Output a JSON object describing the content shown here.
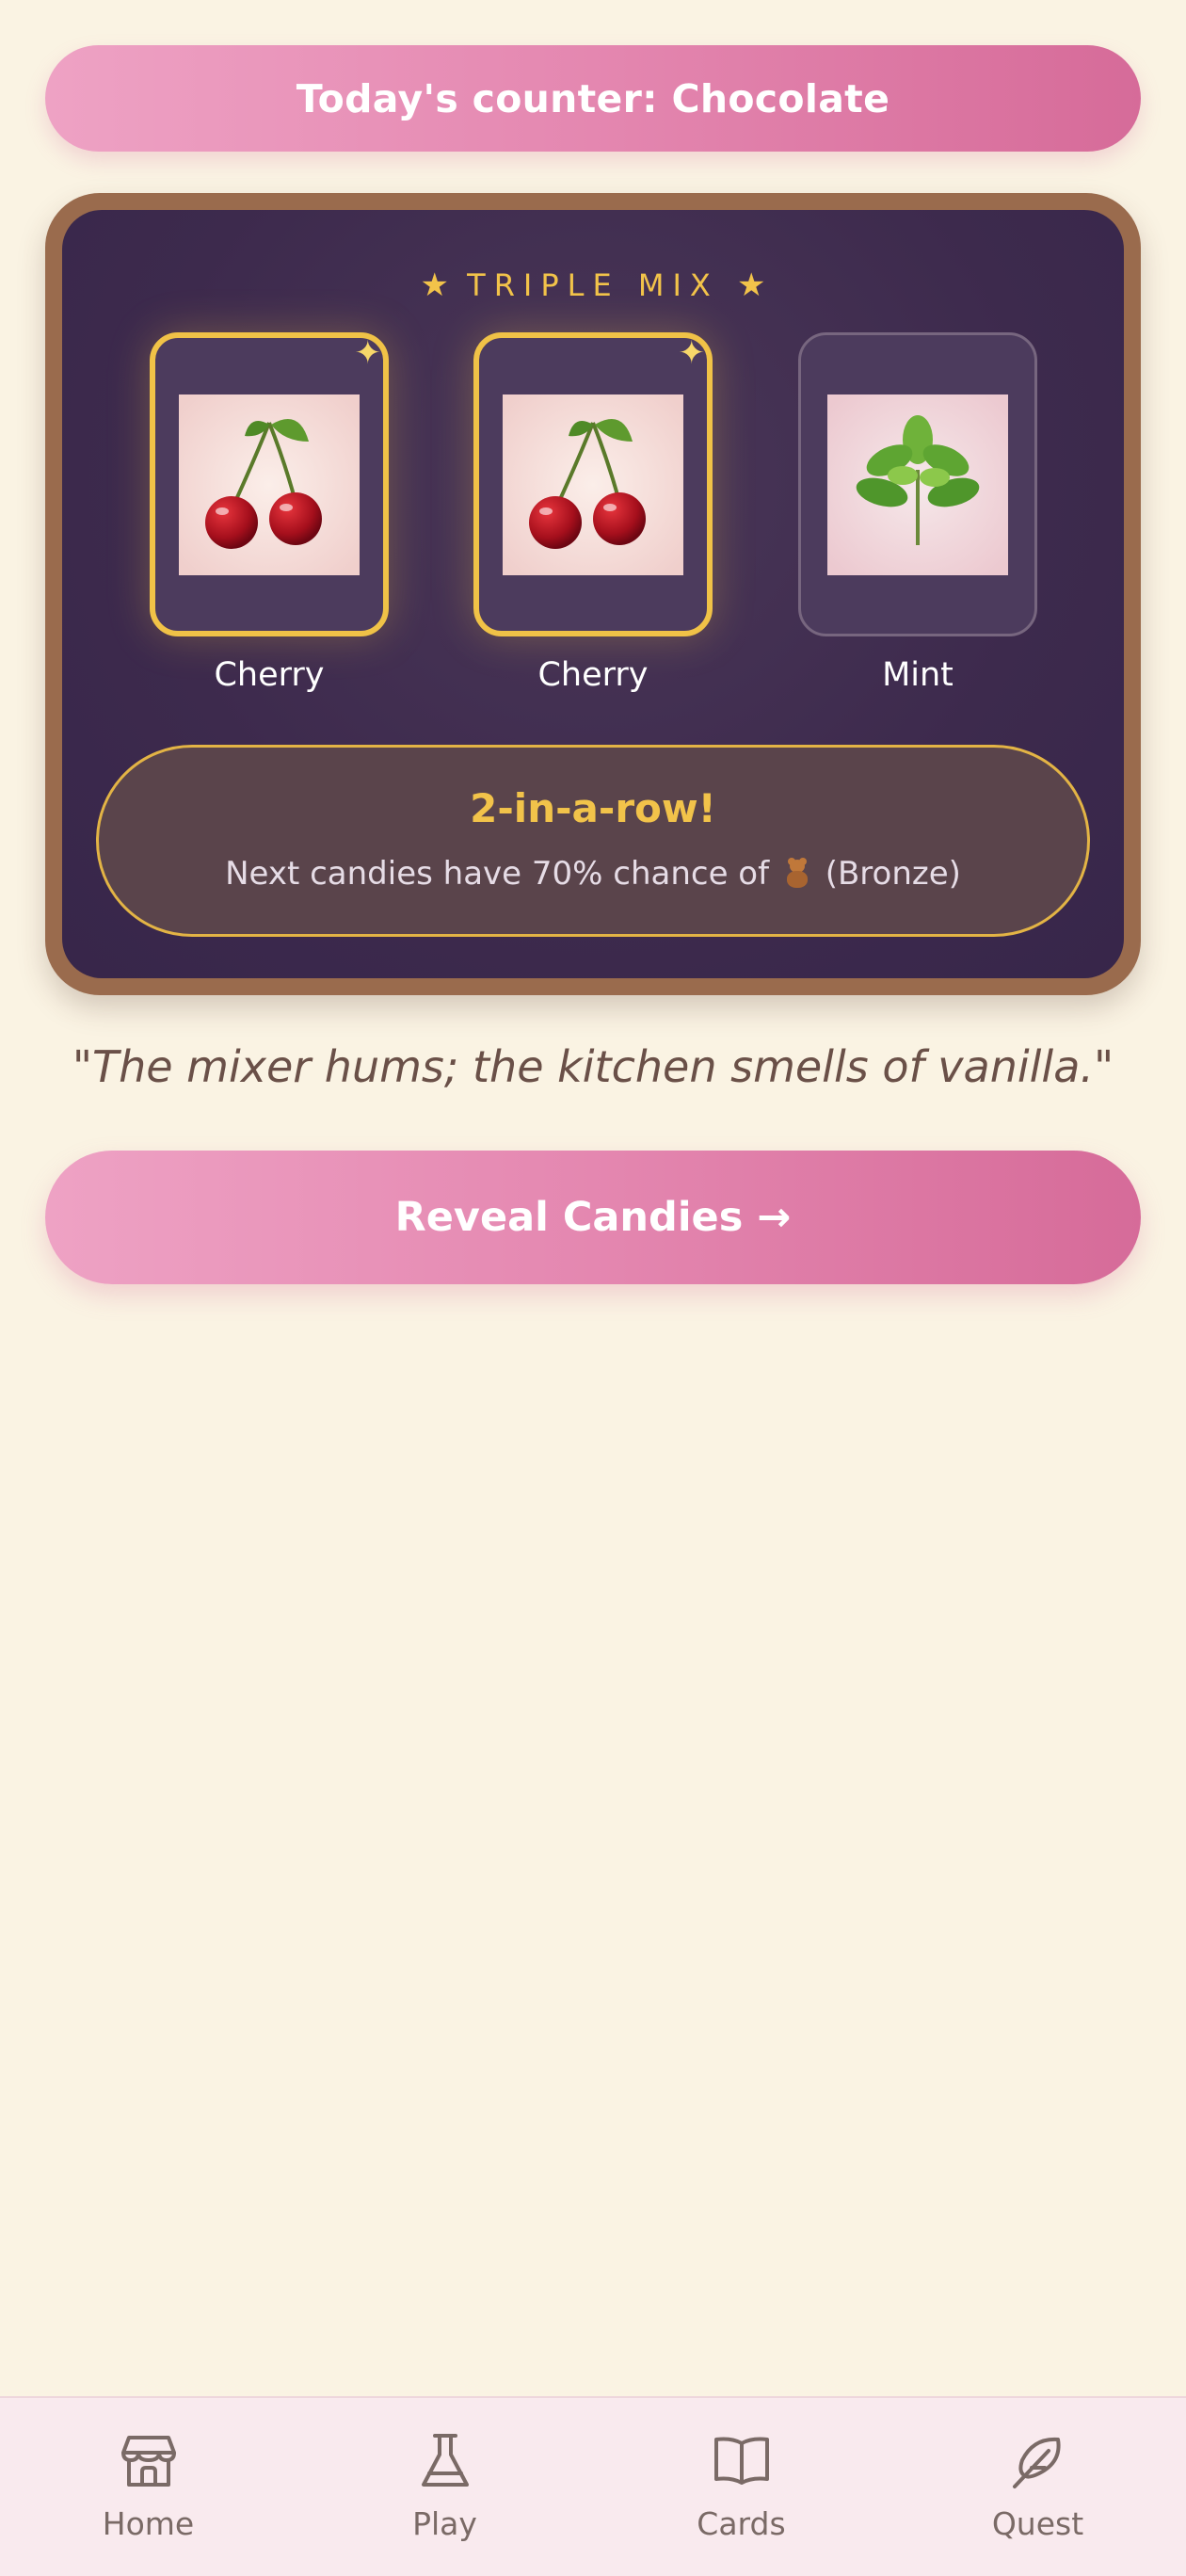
{
  "banner": {
    "text": "Today's counter: Chocolate"
  },
  "machine": {
    "title": "TRIPLE MIX",
    "title_star": "★",
    "reels": [
      {
        "label": "Cherry",
        "image": "cherry-image",
        "highlighted": true
      },
      {
        "label": "Cherry",
        "image": "cherry-image",
        "highlighted": true
      },
      {
        "label": "Mint",
        "image": "mint-image",
        "highlighted": false
      }
    ],
    "result": {
      "title": "2-in-a-row!",
      "text_before": "Next candies have 70% chance of",
      "icon": "teddy-bear-icon",
      "text_after": "(Bronze)"
    }
  },
  "quote": "\"The mixer hums; the kitchen smells of vanilla.\"",
  "reveal_button": {
    "label": "Reveal Candies →"
  },
  "nav": {
    "items": [
      {
        "label": "Home",
        "icon": "shop-icon"
      },
      {
        "label": "Play",
        "icon": "flask-icon"
      },
      {
        "label": "Cards",
        "icon": "book-icon"
      },
      {
        "label": "Quest",
        "icon": "feather-icon"
      }
    ]
  },
  "colors": {
    "background": "#faf3e3",
    "accent_pink": "#e487b0",
    "gold": "#f2c34a",
    "machine_frame": "#9a6b4d",
    "machine_body": "#3d2a4d"
  }
}
